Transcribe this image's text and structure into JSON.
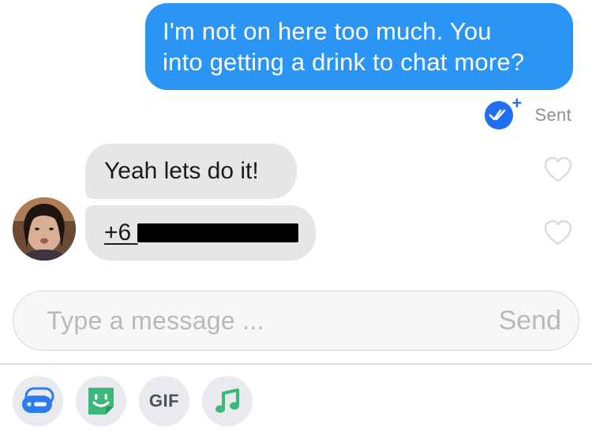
{
  "conversation": {
    "outgoing": {
      "text_line1": "I'm not on here too much. You",
      "text_line2": "into getting a drink to chat more?",
      "status": "Sent",
      "receipt_badge": "+"
    },
    "incoming": [
      {
        "text": "Yeah lets do it!",
        "liked": false
      },
      {
        "text": "+61 410 718 981",
        "visible_text": "+6",
        "redacted": true,
        "liked": false
      }
    ]
  },
  "composer": {
    "placeholder": "Type a message ...",
    "send_label": "Send"
  },
  "toolbar": {
    "items": [
      {
        "name": "smart-reply",
        "icon": "chat-bubbles-icon"
      },
      {
        "name": "sticker",
        "icon": "smiley-sticker-icon"
      },
      {
        "name": "gif",
        "label": "GIF"
      },
      {
        "name": "music",
        "icon": "music-note-icon"
      }
    ]
  },
  "colors": {
    "outgoing_bubble": "#2b95f5",
    "incoming_bubble": "#e6e6e7",
    "receipt": "#1f6df0",
    "sticker": "#3cb97a",
    "music": "#3cb97a",
    "chat_icon": "#2b7cf0"
  }
}
